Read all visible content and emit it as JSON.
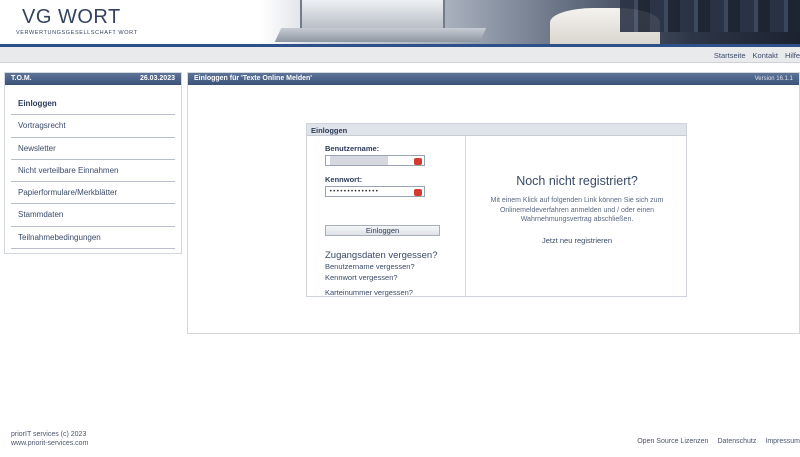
{
  "header": {
    "logo_vg": "VG",
    "logo_wort": "WORT",
    "logo_sub": "VERWERTUNGSGESELLSCHAFT WORT"
  },
  "topnav": {
    "links": [
      "Startseite",
      "Kontakt",
      "Hilfe"
    ]
  },
  "sidebar": {
    "title": "T.O.M.",
    "date": "26.03.2023",
    "items": [
      {
        "label": "Einloggen",
        "active": true
      },
      {
        "label": "Vortragsrecht"
      },
      {
        "label": "Newsletter"
      },
      {
        "label": "Nicht verteilbare Einnahmen"
      },
      {
        "label": "Papierformulare/Merkblätter"
      },
      {
        "label": "Stammdaten"
      },
      {
        "label": "Teilnahmebedingungen"
      }
    ]
  },
  "main": {
    "title": "Einloggen für 'Texte Online Melden'",
    "version": "Version 16.1.1"
  },
  "login": {
    "box_title": "Einloggen",
    "username_label": "Benutzername:",
    "username_value": "",
    "password_label": "Kennwort:",
    "password_value": "••••••••••••••",
    "submit_label": "Einloggen",
    "forgot_title": "Zugangsdaten vergessen?",
    "forgot_links": [
      "Benutzername vergessen?",
      "Kennwort vergessen?",
      "Karteinummer vergessen?"
    ]
  },
  "register": {
    "title": "Noch nicht registriert?",
    "text": "Mit einem Klick auf folgenden Link können Sie sich zum Onlinemeldeverfahren anmelden und / oder einen Wahrnehmungsvertrag abschließen.",
    "link": "Jetzt neu registrieren"
  },
  "footer": {
    "company": "priorIT services (c) 2023",
    "website": "www.priorit-services.com",
    "links": [
      "Open Source Lizenzen",
      "Datenschutz",
      "Impressum"
    ]
  },
  "colors": {
    "accent_blue": "#2d4f8a",
    "panel_header": "#3b5279",
    "text": "#3a4a66"
  }
}
